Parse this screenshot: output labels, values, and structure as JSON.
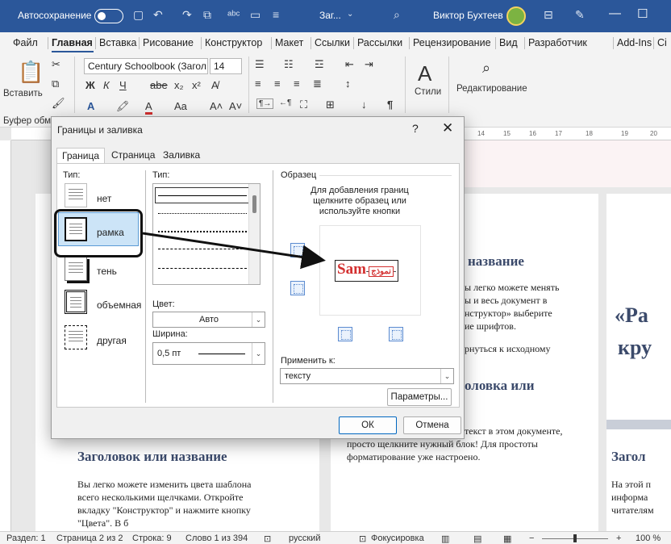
{
  "titlebar": {
    "autosave_label": "Автосохранение",
    "doc_name": "Заг...",
    "user_name": "Виктор Бухтеев"
  },
  "menu": {
    "items": [
      "Файл",
      "Главная",
      "Вставка",
      "Рисование",
      "Конструктор",
      "Макет",
      "Ссылки",
      "Рассылки",
      "Рецензирование",
      "Вид",
      "Разработчик",
      "Add-Ins",
      "Ci"
    ],
    "active_index": 1
  },
  "ribbon": {
    "paste_label": "Вставить",
    "clipboard_group_label": "Буфер обме",
    "font_name": "Century Schoolbook (Загол",
    "font_size": "14",
    "bold": "Ж",
    "italic": "К",
    "underline": "Ч",
    "strike": "abe",
    "subscript": "x₂",
    "superscript": "x²",
    "font_color": "A",
    "change_case": "Aa",
    "grow": "A˄",
    "shrink": "A˅",
    "styles_label": "Стили",
    "editing_label": "Редактирование"
  },
  "ruler": {
    "labels": [
      "14",
      "15",
      "16",
      "17",
      "18",
      "19",
      "20"
    ]
  },
  "dialog": {
    "title": "Границы и заливка",
    "help": "?",
    "close": "✕",
    "tabs": [
      "Граница",
      "Страница",
      "Заливка"
    ],
    "active_tab": 0,
    "type_label": "Тип:",
    "types": [
      {
        "label": "нет",
        "icon": "border-none-icon"
      },
      {
        "label": "рамка",
        "icon": "border-box-icon"
      },
      {
        "label": "тень",
        "icon": "border-shadow-icon"
      },
      {
        "label": "объемная",
        "icon": "border-3d-icon"
      },
      {
        "label": "другая",
        "icon": "border-custom-icon"
      }
    ],
    "selected_type": 1,
    "style_label": "Тип:",
    "color_label": "Цвет:",
    "color_value": "Авто",
    "width_label": "Ширина:",
    "width_value": "0,5 пт",
    "sample_label": "Образец",
    "sample_hint": "Для добавления границ щелкните образец или используйте кнопки",
    "sample_text_main": "Sam",
    "sample_text_rtl": "نموذج",
    "apply_label": "Применить к:",
    "apply_value": "тексту",
    "options_button": "Параметры...",
    "ok_button": "ОК",
    "cancel_button": "Отмена"
  },
  "document": {
    "page1": {
      "heading": "Заголовок или название",
      "paragraph": [
        "Вы легко можете изменить цвета шаблона",
        "всего несколькими щелчками. Откройте",
        "вкладку \"Конструктор\" и нажмите кнопку",
        "\"Цвета\". В        б"
      ]
    },
    "page2": {
      "heading1": "название",
      "paragraph1": [
        "ы легко можете менять",
        "ы и весь документ в",
        "нструктор» выберите",
        "ие шрифтов."
      ],
      "line_extra": "рнуться к исходному",
      "heading2": "оловка или",
      "paragraph2": [
        "текст в этом документе,",
        "просто щелкните нужный блок! Для простоты",
        "форматирование уже настроено."
      ]
    },
    "page3": {
      "big1": "«Ра",
      "big2": "кру",
      "heading": "Загол",
      "paragraph": [
        "На этой п",
        "информа",
        "читателям"
      ]
    }
  },
  "statusbar": {
    "section": "Раздел: 1",
    "page": "Страница 2 из 2",
    "line": "Строка: 9",
    "words": "Слово 1 из 394",
    "language": "русский",
    "focus": "Фокусировка",
    "zoom": "100 %"
  },
  "colors": {
    "title_blue": "#2b579a",
    "accent_red": "#d32f2f",
    "heading_navy": "#3b4a6b"
  }
}
